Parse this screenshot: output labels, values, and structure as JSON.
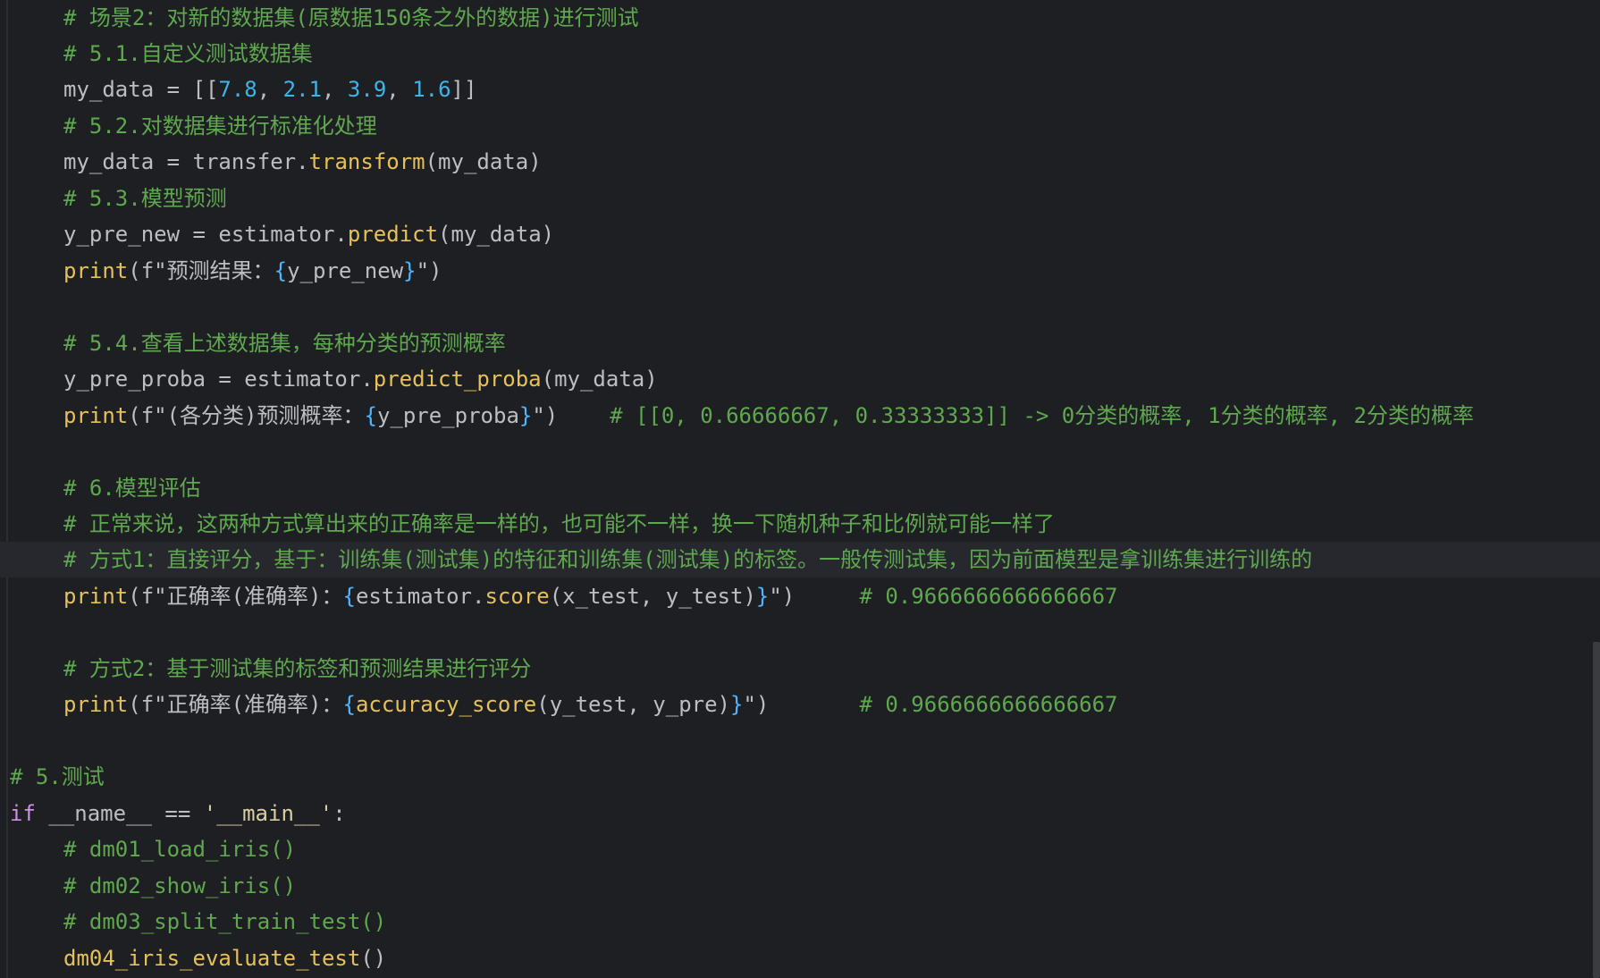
{
  "editor": {
    "lines": [
      {
        "parts": [
          {
            "t": "# 场景2：对新的数据集(原数据150条之外的数据)进行测试",
            "c": "cm"
          }
        ]
      },
      {
        "parts": [
          {
            "t": "# 5.1.自定义测试数据集",
            "c": "cm"
          }
        ]
      },
      {
        "parts": [
          {
            "t": "my_data = [[",
            "c": "txt"
          },
          {
            "t": "7.8",
            "c": "num"
          },
          {
            "t": ", ",
            "c": "txt"
          },
          {
            "t": "2.1",
            "c": "num"
          },
          {
            "t": ", ",
            "c": "txt"
          },
          {
            "t": "3.9",
            "c": "num"
          },
          {
            "t": ", ",
            "c": "txt"
          },
          {
            "t": "1.6",
            "c": "num"
          },
          {
            "t": "]]",
            "c": "txt"
          }
        ]
      },
      {
        "parts": [
          {
            "t": "# 5.2.对数据集进行标准化处理",
            "c": "cm"
          }
        ]
      },
      {
        "parts": [
          {
            "t": "my_data = transfer.",
            "c": "txt"
          },
          {
            "t": "transform",
            "c": "fn"
          },
          {
            "t": "(my_data)",
            "c": "txt"
          }
        ]
      },
      {
        "parts": [
          {
            "t": "# 5.3.模型预测",
            "c": "cm"
          }
        ]
      },
      {
        "parts": [
          {
            "t": "y_pre_new = estimator.",
            "c": "txt"
          },
          {
            "t": "predict",
            "c": "fn"
          },
          {
            "t": "(my_data)",
            "c": "txt"
          }
        ]
      },
      {
        "parts": [
          {
            "t": "print",
            "c": "bi"
          },
          {
            "t": "(f\"预测结果：",
            "c": "txt"
          },
          {
            "t": "{",
            "c": "brace"
          },
          {
            "t": "y_pre_new",
            "c": "txt"
          },
          {
            "t": "}",
            "c": "brace"
          },
          {
            "t": "\")",
            "c": "txt"
          }
        ]
      },
      {
        "parts": []
      },
      {
        "parts": [
          {
            "t": "# 5.4.查看上述数据集，每种分类的预测概率",
            "c": "cm"
          }
        ]
      },
      {
        "parts": [
          {
            "t": "y_pre_proba = estimator.",
            "c": "txt"
          },
          {
            "t": "predict_proba",
            "c": "fn"
          },
          {
            "t": "(my_data)",
            "c": "txt"
          }
        ]
      },
      {
        "parts": [
          {
            "t": "print",
            "c": "bi"
          },
          {
            "t": "(f\"(各分类)预测概率：",
            "c": "txt"
          },
          {
            "t": "{",
            "c": "brace"
          },
          {
            "t": "y_pre_proba",
            "c": "txt"
          },
          {
            "t": "}",
            "c": "brace"
          },
          {
            "t": "\")    ",
            "c": "txt"
          },
          {
            "t": "# [[0, 0.66666667, 0.33333333]] -> 0分类的概率, 1分类的概率, 2分类的概率",
            "c": "cm"
          }
        ]
      },
      {
        "parts": []
      },
      {
        "parts": [
          {
            "t": "# 6.模型评估",
            "c": "cm"
          }
        ]
      },
      {
        "parts": [
          {
            "t": "# 正常来说，这两种方式算出来的正确率是一样的，也可能不一样，换一下随机种子和比例就可能一样了",
            "c": "cm"
          }
        ]
      },
      {
        "parts": [
          {
            "t": "# 方式1：直接评分，基于：训练集(测试集)的特征和训练集(测试集)的标签。一般传测试集，因为前面模型是拿训练集进行训练的",
            "c": "cm"
          }
        ]
      },
      {
        "parts": [
          {
            "t": "print",
            "c": "bi"
          },
          {
            "t": "(f\"正确率(准确率)：",
            "c": "txt"
          },
          {
            "t": "{",
            "c": "brace"
          },
          {
            "t": "estimator.",
            "c": "txt"
          },
          {
            "t": "score",
            "c": "fn"
          },
          {
            "t": "(x_test, y_test)",
            "c": "txt"
          },
          {
            "t": "}",
            "c": "brace"
          },
          {
            "t": "\")     ",
            "c": "txt"
          },
          {
            "t": "# 0.9666666666666667",
            "c": "cm"
          }
        ]
      },
      {
        "parts": []
      },
      {
        "parts": [
          {
            "t": "# 方式2：基于测试集的标签和预测结果进行评分",
            "c": "cm"
          }
        ]
      },
      {
        "parts": [
          {
            "t": "print",
            "c": "bi"
          },
          {
            "t": "(f\"正确率(准确率)：",
            "c": "txt"
          },
          {
            "t": "{",
            "c": "brace"
          },
          {
            "t": "accuracy_score",
            "c": "fn"
          },
          {
            "t": "(y_test, y_pre)",
            "c": "txt"
          },
          {
            "t": "}",
            "c": "brace"
          },
          {
            "t": "\")       ",
            "c": "txt"
          },
          {
            "t": "# 0.9666666666666667",
            "c": "cm"
          }
        ]
      },
      {
        "parts": []
      },
      {
        "parts": [
          {
            "t": "# 5.测试",
            "c": "cm"
          }
        ]
      },
      {
        "parts": [
          {
            "t": "if",
            "c": "kw"
          },
          {
            "t": " __name__ == ",
            "c": "txt"
          },
          {
            "t": "'__main__'",
            "c": "str"
          },
          {
            "t": ":",
            "c": "txt"
          }
        ]
      },
      {
        "parts": [
          {
            "t": "# dm01_load_iris()",
            "c": "cm"
          }
        ]
      },
      {
        "parts": [
          {
            "t": "# dm02_show_iris()",
            "c": "cm"
          }
        ]
      },
      {
        "parts": [
          {
            "t": "# dm03_split_train_test()",
            "c": "cm"
          }
        ]
      },
      {
        "parts": [
          {
            "t": "dm04_iris_evaluate_test",
            "c": "fn"
          },
          {
            "t": "()",
            "c": "txt"
          }
        ]
      }
    ]
  }
}
